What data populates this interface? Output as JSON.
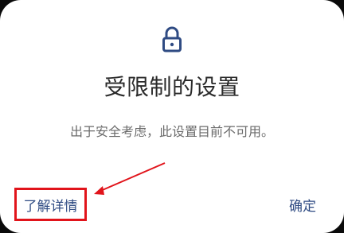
{
  "dialog": {
    "title": "受限制的设置",
    "message": "出于安全考虑，此设置目前不可用。",
    "learn_more_label": "了解详情",
    "ok_label": "确定"
  },
  "icons": {
    "lock": "lock-icon"
  },
  "colors": {
    "accent": "#2f4b83",
    "annotation": "#e1141b"
  }
}
